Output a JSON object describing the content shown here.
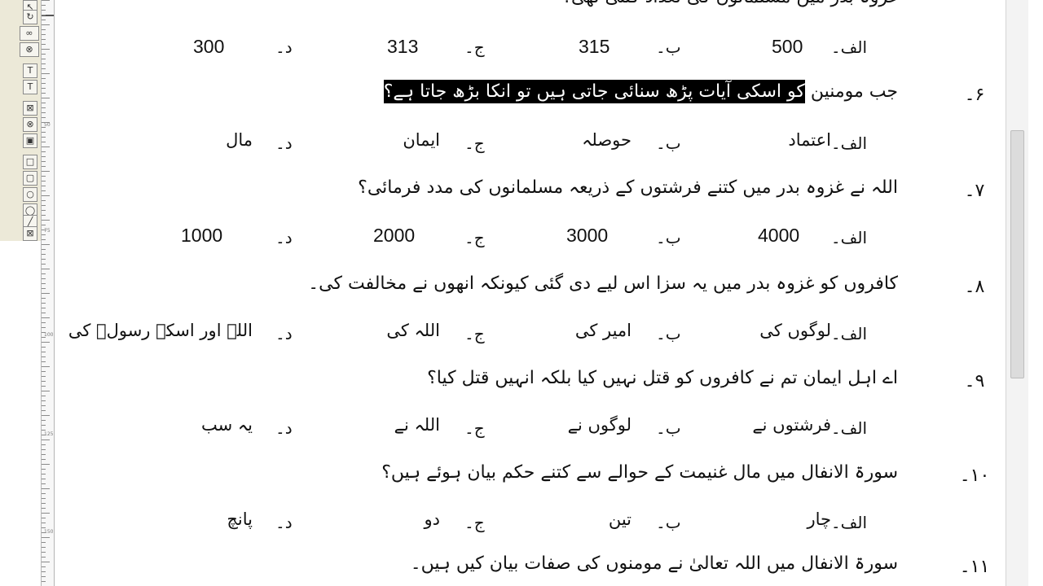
{
  "option_labels": {
    "a": "الف۔",
    "b": "ب۔",
    "c": "ج۔",
    "d": "د۔"
  },
  "toolbar": {
    "buttons": [
      {
        "name": "select-tool-icon",
        "glyph": "↖"
      },
      {
        "name": "rotate-tool-icon",
        "glyph": "↻"
      },
      {
        "name": "link-frames-icon",
        "glyph": "∞"
      },
      {
        "name": "unlink-frames-icon",
        "glyph": "⊗"
      },
      {
        "name": "text-frame-tool-icon",
        "glyph": "T"
      },
      {
        "name": "text-frame-alt-tool-icon",
        "glyph": "T"
      },
      {
        "name": "picture-frame-tool-icon",
        "glyph": "⊠"
      },
      {
        "name": "oval-picture-frame-tool-icon",
        "glyph": "⊗"
      },
      {
        "name": "shaded-frame-tool-icon",
        "glyph": "▣"
      },
      {
        "name": "rectangle-tool-icon",
        "glyph": "□"
      },
      {
        "name": "rounded-rectangle-tool-icon",
        "glyph": "▢"
      },
      {
        "name": "oval-tool-icon",
        "glyph": "○"
      },
      {
        "name": "ellipse-tool-icon",
        "glyph": "◯"
      },
      {
        "name": "line-tool-icon",
        "glyph": "╱"
      },
      {
        "name": "cross-frame-tool-icon",
        "glyph": "⊠"
      }
    ]
  },
  "ruler": {
    "labels": [
      "50",
      "75",
      "100",
      "125",
      "150",
      "175",
      "200"
    ]
  },
  "questions": [
    {
      "number": "",
      "text": "غزوہ بدر میں مسلمانوں کی تعداد کتنی تھی؟",
      "options": {
        "a": "500",
        "b": "315",
        "c": "313",
        "d": "300"
      }
    },
    {
      "number": "۶۔",
      "text_plain": "جب مومنین ",
      "text_highlight": "کو اسکی آیات پڑھ سنائی جاتی ہیں تو انکا بڑھ جاتا ہے؟",
      "options": {
        "a": "اعتماد",
        "b": "حوصلہ",
        "c": "ایمان",
        "d": "مال"
      }
    },
    {
      "number": "۷۔",
      "text": "اللہ نے غزوہ بدر میں کتنے فرشتوں کے ذریعہ مسلمانوں کی مدد فرمائی؟",
      "options": {
        "a": "4000",
        "b": "3000",
        "c": "2000",
        "d": "1000"
      }
    },
    {
      "number": "۸۔",
      "text": "کافروں کو غزوہ بدر میں یہ سزا اس لیے دی گئی کیونکہ انھوں نے مخالفت کی۔",
      "options": {
        "a": "لوگوں کی",
        "b": "امیر کی",
        "c": "اللہ کی",
        "d": "اللہ اور اسکے رسولؐ کی"
      }
    },
    {
      "number": "۹۔",
      "text": "اے اہل ایمان تم نے کافروں کو قتل نہیں کیا بلکہ انہیں قتل کیا؟",
      "options": {
        "a": "فرشتوں نے",
        "b": "لوگوں نے",
        "c": "اللہ نے",
        "d": "یہ سب"
      }
    },
    {
      "number": "۱۰۔",
      "text": "سورۃ الانفال میں مال غنیمت کے حوالے سے کتنے حکم بیان ہوئے ہیں؟",
      "options": {
        "a": "چار",
        "b": "تین",
        "c": "دو",
        "d": "پانچ"
      }
    },
    {
      "number": "۱۱۔",
      "text": "سورۃ الانفال میں اللہ تعالیٰ نے مومنوں کی صفات بیان کیں ہیں۔"
    }
  ]
}
